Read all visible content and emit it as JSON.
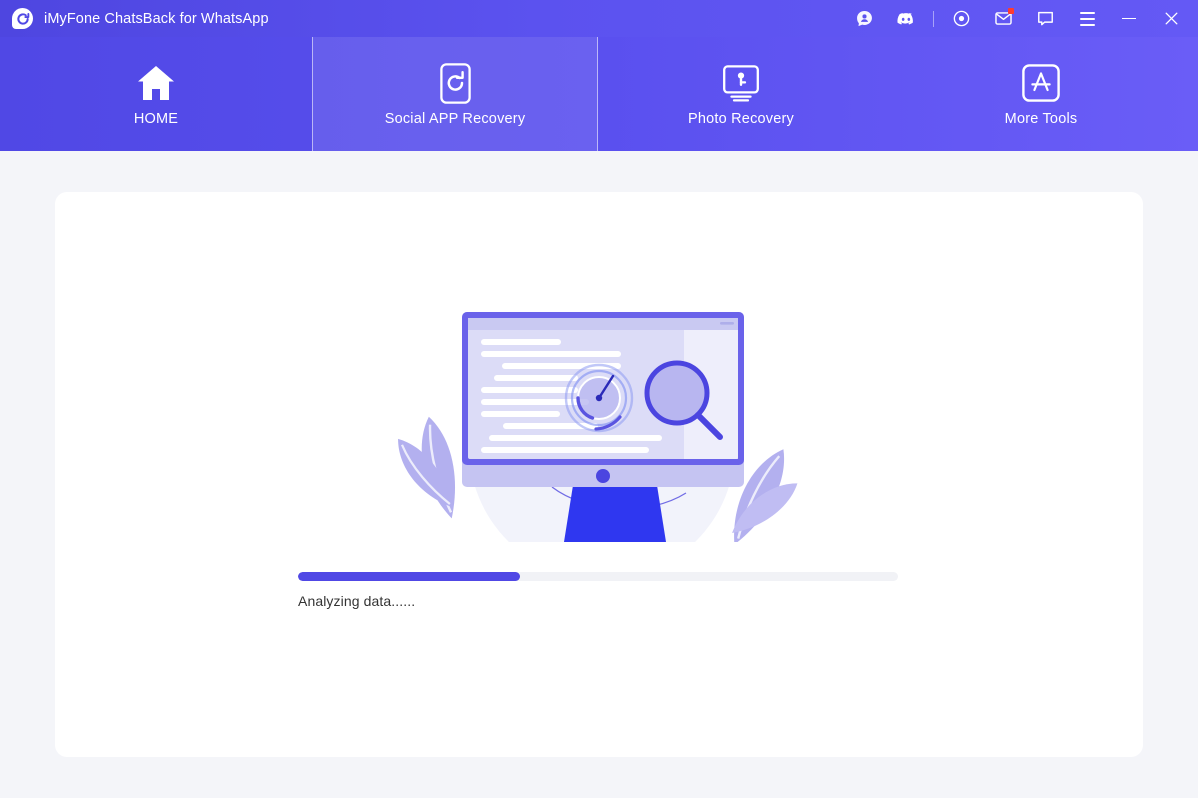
{
  "window": {
    "title": "iMyFone ChatsBack for WhatsApp",
    "logo_icon": "chatsback-logo-icon",
    "controls": [
      {
        "name": "account-icon",
        "label": "Account"
      },
      {
        "name": "discord-icon",
        "label": "Discord"
      },
      {
        "name": "divider",
        "label": ""
      },
      {
        "name": "target-icon",
        "label": "Center"
      },
      {
        "name": "mail-icon",
        "label": "Messages",
        "badge": true
      },
      {
        "name": "feedback-icon",
        "label": "Feedback"
      },
      {
        "name": "menu-icon",
        "label": "Menu"
      },
      {
        "name": "minimize-icon",
        "label": "Minimize"
      },
      {
        "name": "close-icon",
        "label": "Close"
      }
    ]
  },
  "nav": {
    "active_index": 1,
    "tabs": [
      {
        "label": "HOME",
        "icon": "home-icon"
      },
      {
        "label": "Social APP Recovery",
        "icon": "phone-refresh-icon"
      },
      {
        "label": "Photo Recovery",
        "icon": "monitor-photo-icon"
      },
      {
        "label": "More Tools",
        "icon": "app-store-icon"
      }
    ]
  },
  "main": {
    "illustration": "desktop-scanning-illustration",
    "progress": {
      "percent": 37,
      "status_text": "Analyzing data......"
    }
  },
  "colors": {
    "brand": "#5048e5",
    "titlebar_start": "#4e46e0",
    "titlebar_end": "#6459f5",
    "page_bg": "#f4f5f9",
    "card_bg": "#ffffff",
    "track": "#f1f2f6",
    "status_text": "#333333",
    "badge": "#ff3b30"
  }
}
